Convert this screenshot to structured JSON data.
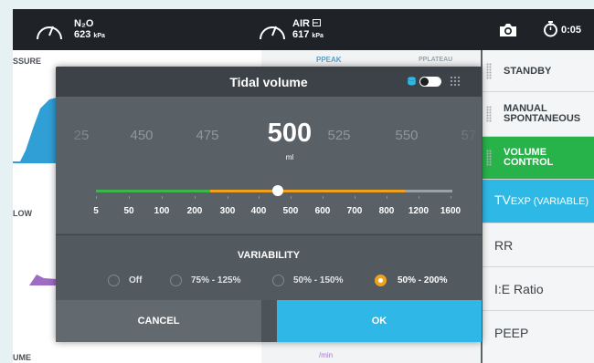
{
  "status_bar": {
    "gas1": {
      "name": "N₂O",
      "value": "623",
      "unit": "kPa"
    },
    "gas2": {
      "name": "AIR",
      "value": "617",
      "unit": "kPa"
    },
    "timer": "0:05"
  },
  "background": {
    "chart_labels": [
      "SSURE",
      "LOW",
      "UME"
    ],
    "p_peak": "PPEAK",
    "p_plateau": "PPLATEAU",
    "per_min": "/min"
  },
  "side_menu": {
    "standby": "STANDBY",
    "manual_line1": "MANUAL",
    "manual_line2": "SPONTANEOUS",
    "volume_line1": "VOLUME",
    "volume_line2": "CONTROL",
    "tv_prefix": "TV",
    "tv_suffix": "EXP (VARIABLE)",
    "rr": "RR",
    "ie": "I:E Ratio",
    "peep": "PEEP"
  },
  "dialog": {
    "title": "Tidal volume",
    "scale_values": [
      "25",
      "450",
      "475",
      "500",
      "525",
      "550",
      "57"
    ],
    "selected_value": "500",
    "unit": "ml",
    "slider_labels": [
      "5",
      "50",
      "100",
      "200",
      "300",
      "400",
      "500",
      "600",
      "700",
      "800",
      "1200",
      "1600"
    ],
    "slider_level": 0.55,
    "variability_title": "VARIABILITY",
    "variability_options": [
      "Off",
      "75% - 125%",
      "50% - 150%",
      "50% - 200%"
    ],
    "variability_selected": "50% - 200%",
    "cancel_label": "CANCEL",
    "ok_label": "OK"
  },
  "colors": {
    "accent_blue": "#2fb8e7",
    "mode_green": "#27b24a",
    "variability_orange": "#f0a21e",
    "slider_green": "#3cb54a",
    "waveform_blue": "#2f9fd6",
    "waveform_purple": "#9e6cc3"
  }
}
